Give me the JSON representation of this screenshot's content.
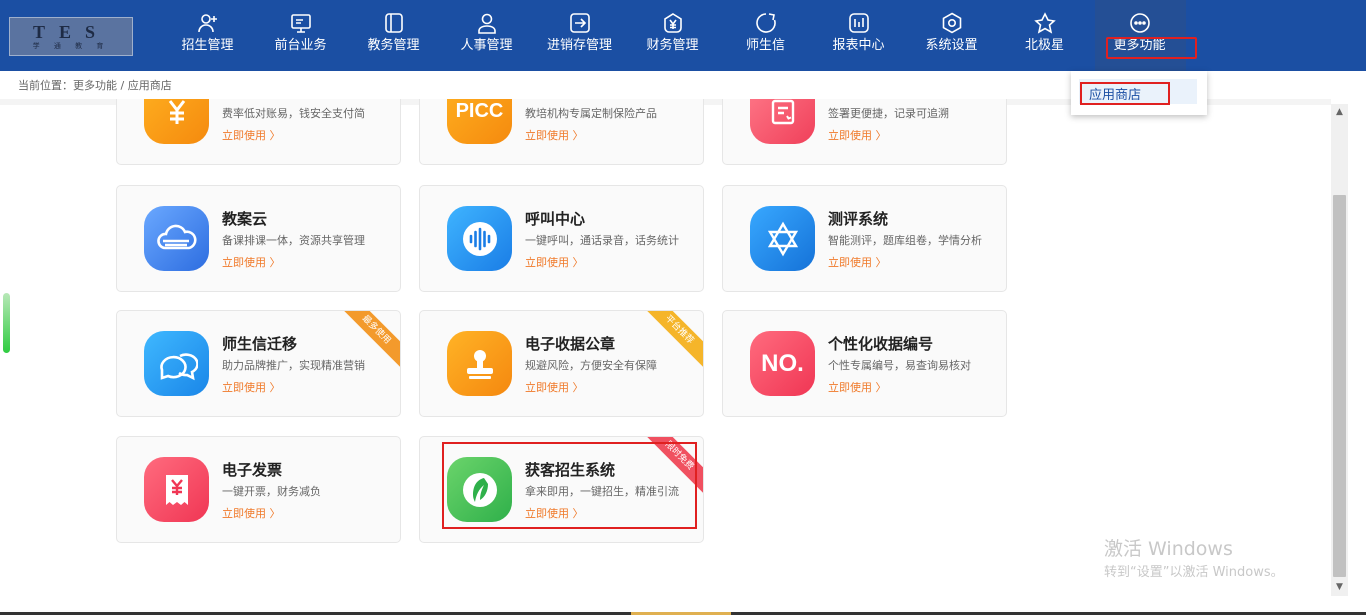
{
  "logo": {
    "line1": "TES",
    "line2": "学 通 教 育"
  },
  "nav": [
    {
      "label": "招生管理",
      "icon": "user-add-icon"
    },
    {
      "label": "前台业务",
      "icon": "monitor-icon"
    },
    {
      "label": "教务管理",
      "icon": "book-icon"
    },
    {
      "label": "人事管理",
      "icon": "person-icon"
    },
    {
      "label": "进销存管理",
      "icon": "inventory-icon"
    },
    {
      "label": "财务管理",
      "icon": "finance-icon"
    },
    {
      "label": "师生信",
      "icon": "chat-icon"
    },
    {
      "label": "报表中心",
      "icon": "report-icon"
    },
    {
      "label": "系统设置",
      "icon": "settings-icon"
    },
    {
      "label": "北极星",
      "icon": "star-icon"
    },
    {
      "label": "更多功能",
      "icon": "more-icon"
    }
  ],
  "breadcrumb": "当前位置：更多功能 / 应用商店",
  "dropdown": {
    "item": "应用商店"
  },
  "use_label": "立即使用",
  "cards": [
    {
      "title": "",
      "desc": "费率低对账易，钱安全支付简",
      "icon": "yen-icon",
      "ribbon": ""
    },
    {
      "title": "",
      "desc": "教培机构专属定制保险产品",
      "icon": "picc-icon",
      "icon_text": "PICC",
      "ribbon": ""
    },
    {
      "title": "",
      "desc": "签署更便捷，记录可追溯",
      "icon": "contract-icon",
      "ribbon": ""
    },
    {
      "title": "教案云",
      "desc": "备课排课一体，资源共享管理",
      "icon": "cloud-icon",
      "ribbon": ""
    },
    {
      "title": "呼叫中心",
      "desc": "一键呼叫，通话录音，话务统计",
      "icon": "voice-icon",
      "ribbon": ""
    },
    {
      "title": "测评系统",
      "desc": "智能测评，题库组卷，学情分析",
      "icon": "star-of-david-icon",
      "ribbon": ""
    },
    {
      "title": "师生信迁移",
      "desc": "助力品牌推广，实现精准营销",
      "icon": "chat-bubbles-icon",
      "ribbon": "最多使用"
    },
    {
      "title": "电子收据公章",
      "desc": "规避风险，方便安全有保障",
      "icon": "stamp-icon",
      "ribbon": "平台推荐"
    },
    {
      "title": "个性化收据编号",
      "desc": "个性专属编号，易查询易核对",
      "icon": "number-icon",
      "icon_text": "NO.",
      "ribbon": ""
    },
    {
      "title": "电子发票",
      "desc": "一键开票，财务减负",
      "icon": "invoice-icon",
      "ribbon": ""
    },
    {
      "title": "获客招生系统",
      "desc": "拿来即用，一键招生，精准引流",
      "icon": "leaf-icon",
      "ribbon": "限时免费"
    }
  ],
  "watermark": {
    "line1": "激活 Windows",
    "line2": "转到“设置”以激活 Windows。"
  },
  "colors": {
    "topbar": "#1b4fa3",
    "accent": "#f07a2a",
    "highlight": "#e02020"
  }
}
